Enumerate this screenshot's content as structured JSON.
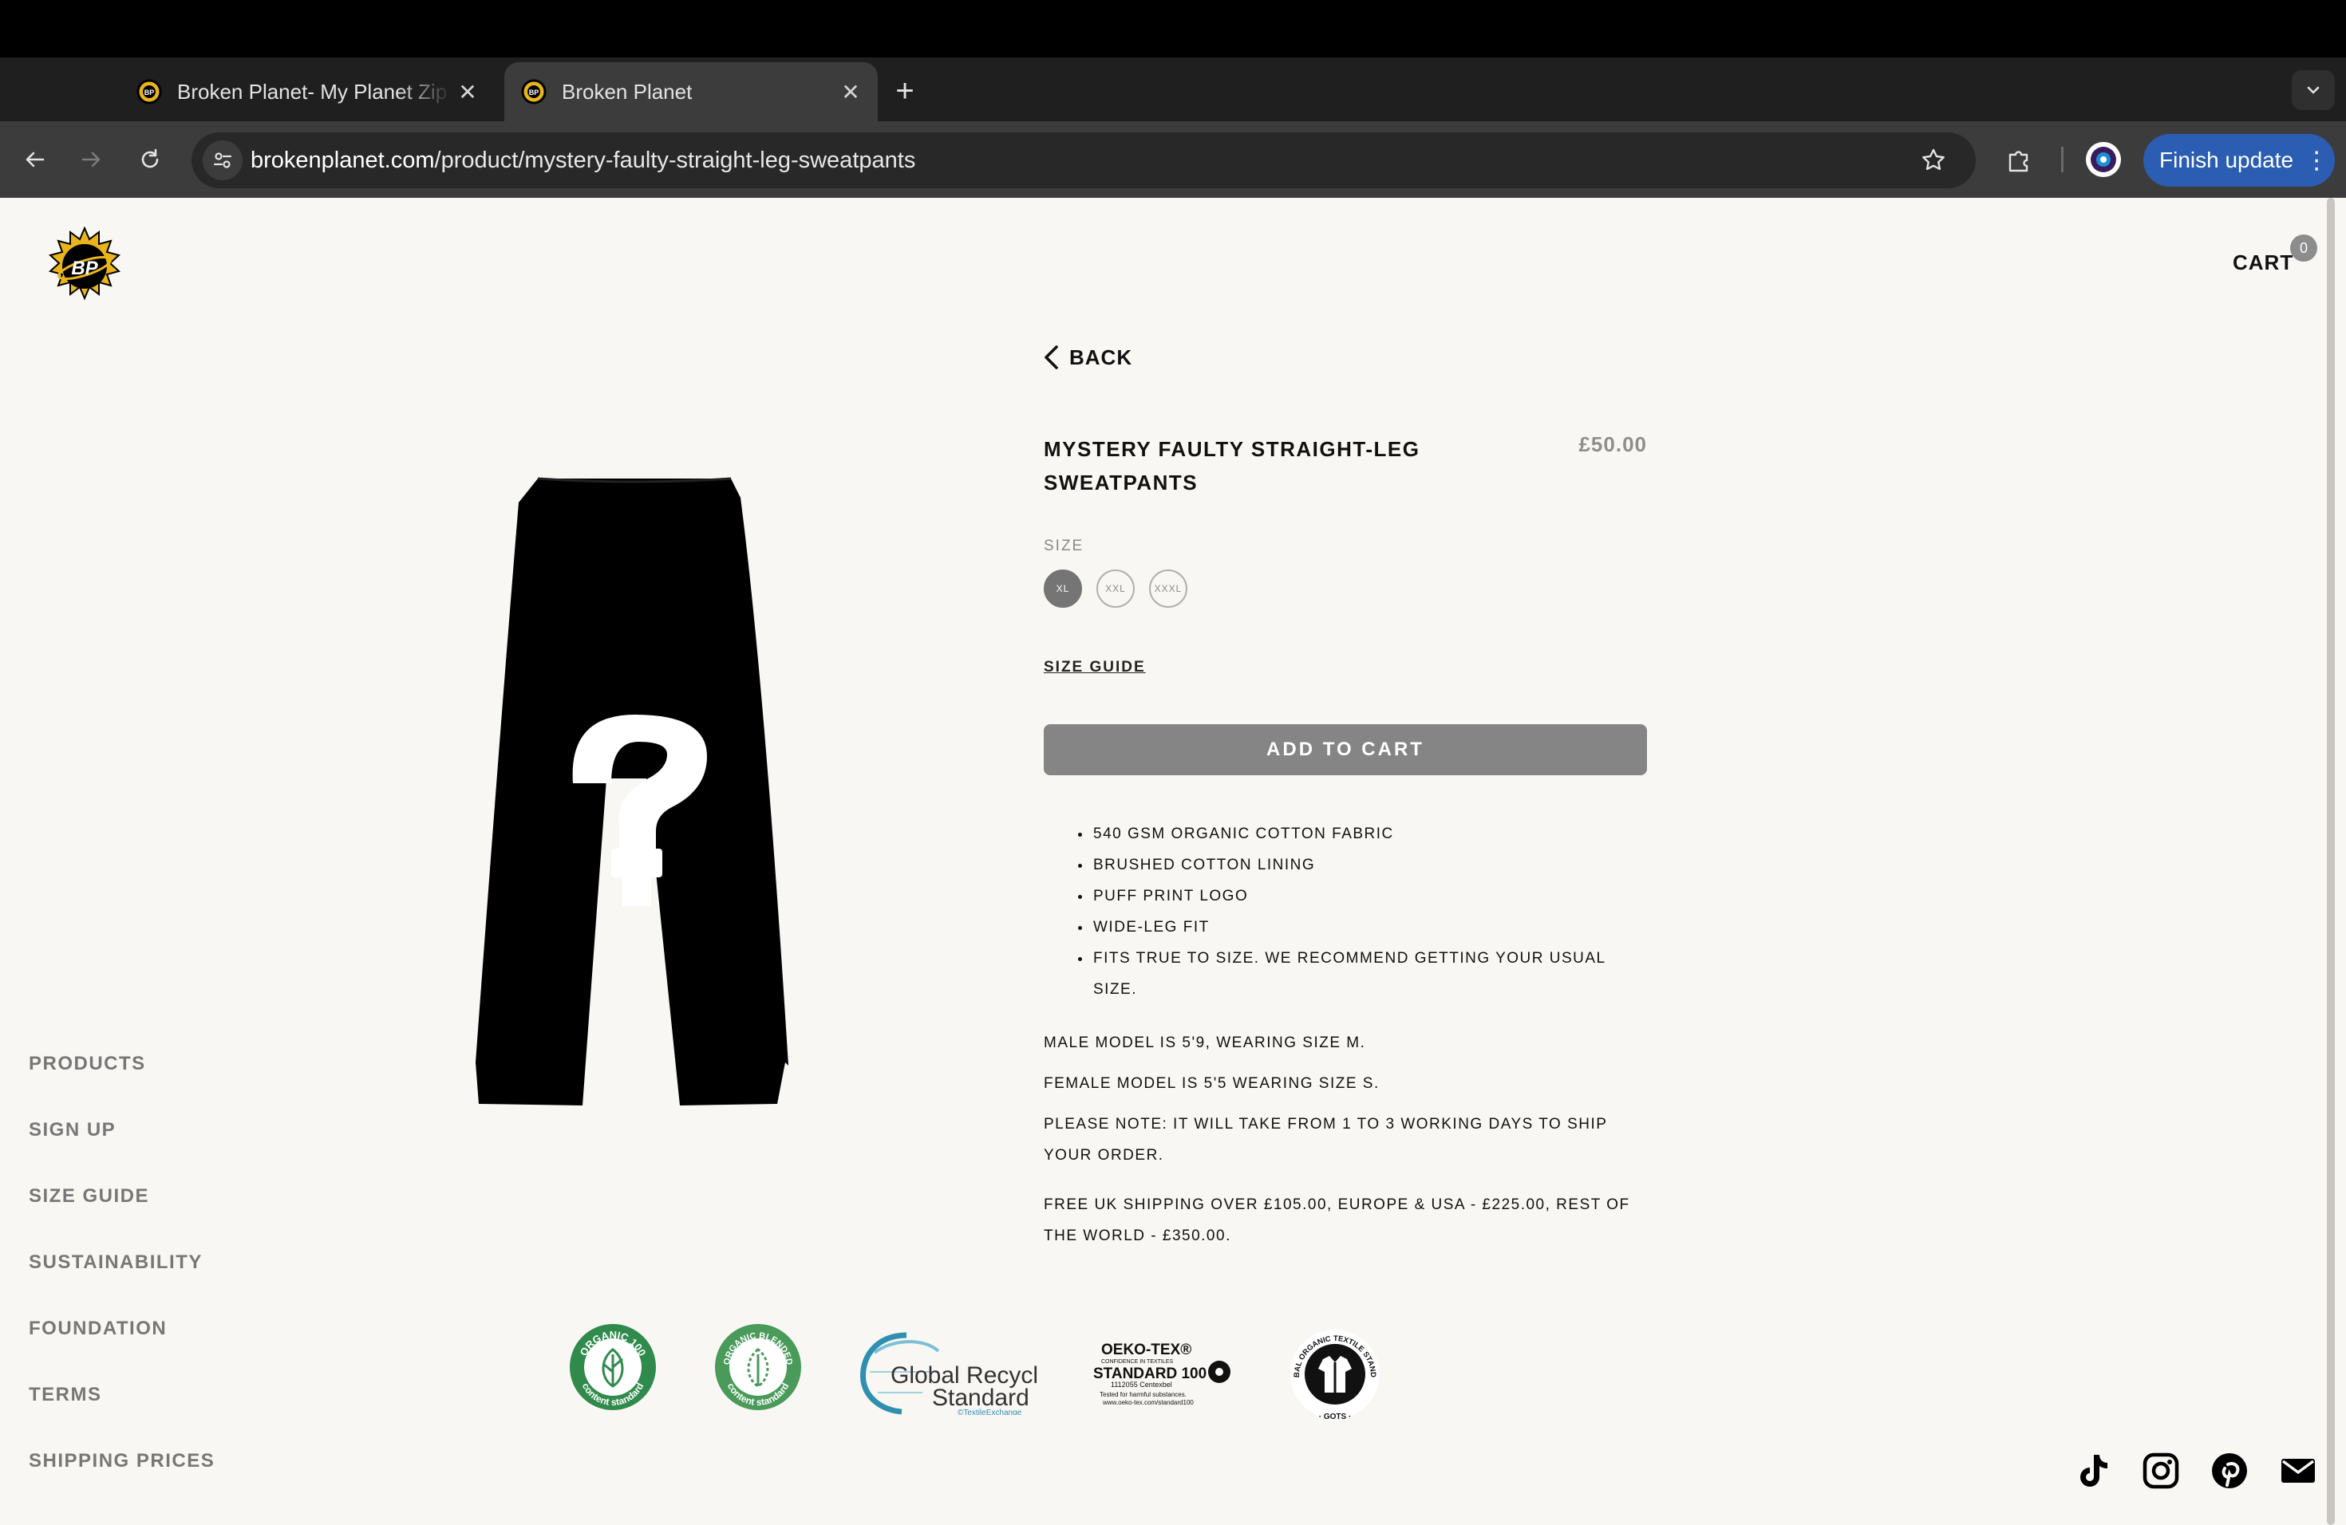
{
  "browser": {
    "tabs": [
      {
        "title": "Broken Planet- My Planet Zip",
        "active": false
      },
      {
        "title": "Broken Planet",
        "active": true
      }
    ],
    "close_glyph": "✕",
    "new_tab_glyph": "+",
    "url": {
      "host": "brokenplanet.com",
      "path": "/product/mystery-faulty-straight-leg-sweatpants"
    },
    "update_button": "Finish update",
    "update_menu_glyph": "⋮",
    "accent_color": "#2b5db3"
  },
  "header": {
    "cart_label": "CART",
    "cart_count": "0"
  },
  "product": {
    "back_label": "BACK",
    "name": "MYSTERY FAULTY STRAIGHT-LEG SWEATPANTS",
    "price": "£50.00",
    "size_label": "SIZE",
    "sizes": [
      {
        "label": "XL",
        "selected": true
      },
      {
        "label": "XXL",
        "selected": false
      },
      {
        "label": "XXXL",
        "selected": false
      }
    ],
    "size_guide_label": "SIZE GUIDE",
    "add_to_cart_label": "ADD TO CART",
    "features": [
      "540 GSM ORGANIC COTTON FABRIC",
      "BRUSHED COTTON LINING",
      "PUFF PRINT LOGO",
      "WIDE-LEG FIT",
      "FITS TRUE TO SIZE. WE RECOMMEND GETTING YOUR USUAL SIZE."
    ],
    "male_model": "MALE MODEL IS 5'9, WEARING SIZE M.",
    "female_model": "FEMALE MODEL IS 5'5 WEARING SIZE S.",
    "shipping_note": "PLEASE NOTE: IT WILL TAKE FROM 1 TO 3 WORKING DAYS TO SHIP YOUR ORDER.",
    "free_shipping": "FREE UK SHIPPING OVER £105.00, EUROPE & USA - £225.00, REST OF THE WORLD - £350.00."
  },
  "side_nav": [
    "PRODUCTS",
    "SIGN UP",
    "SIZE GUIDE",
    "SUSTAINABILITY",
    "FOUNDATION",
    "TERMS",
    "SHIPPING PRICES"
  ],
  "certifications": {
    "organic100": {
      "ring": "ORGANIC 100",
      "bottom": "content standard"
    },
    "organic_blended": {
      "ring": "ORGANIC BLENDED",
      "bottom": "content standard"
    },
    "grs": {
      "line1": "Global Recycled",
      "line2": "Standard",
      "small": "©TextileExchange"
    },
    "oekotex": {
      "title": "OEKO-TEX®",
      "sub": "CONFIDENCE IN TEXTILES",
      "standard": "STANDARD 100",
      "code": "1112055 Centexbel",
      "tested": "Tested for harmful substances.",
      "url": "www.oeko-tex.com/standard100"
    },
    "gots": {
      "ring": "GLOBAL ORGANIC TEXTILE STANDARD",
      "bottom": "· GOTS ·"
    }
  },
  "social_icons": [
    "tiktok-icon",
    "instagram-icon",
    "pinterest-icon",
    "mail-icon"
  ]
}
